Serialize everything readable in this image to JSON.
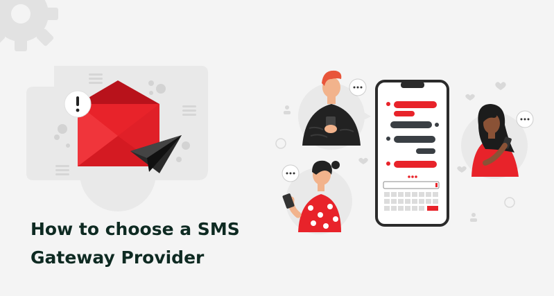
{
  "headline": {
    "line1": "How to choose a SMS",
    "line2": "Gateway Provider"
  },
  "colors": {
    "background": "#f4f4f4",
    "accent_red": "#e8232a",
    "dark_red": "#b8121b",
    "heading": "#0e2a22",
    "phone_outline": "#2b2b2b",
    "grey_shape": "#e6e6e6"
  },
  "illustration": {
    "left": [
      "gear-icon",
      "envelope-icon",
      "paper-plane-icon",
      "exclamation-bubble-icon"
    ],
    "right": [
      "smartphone-chat",
      "man-with-phone",
      "woman-with-phone",
      "woman-texting",
      "typing-bubble-icon"
    ]
  }
}
